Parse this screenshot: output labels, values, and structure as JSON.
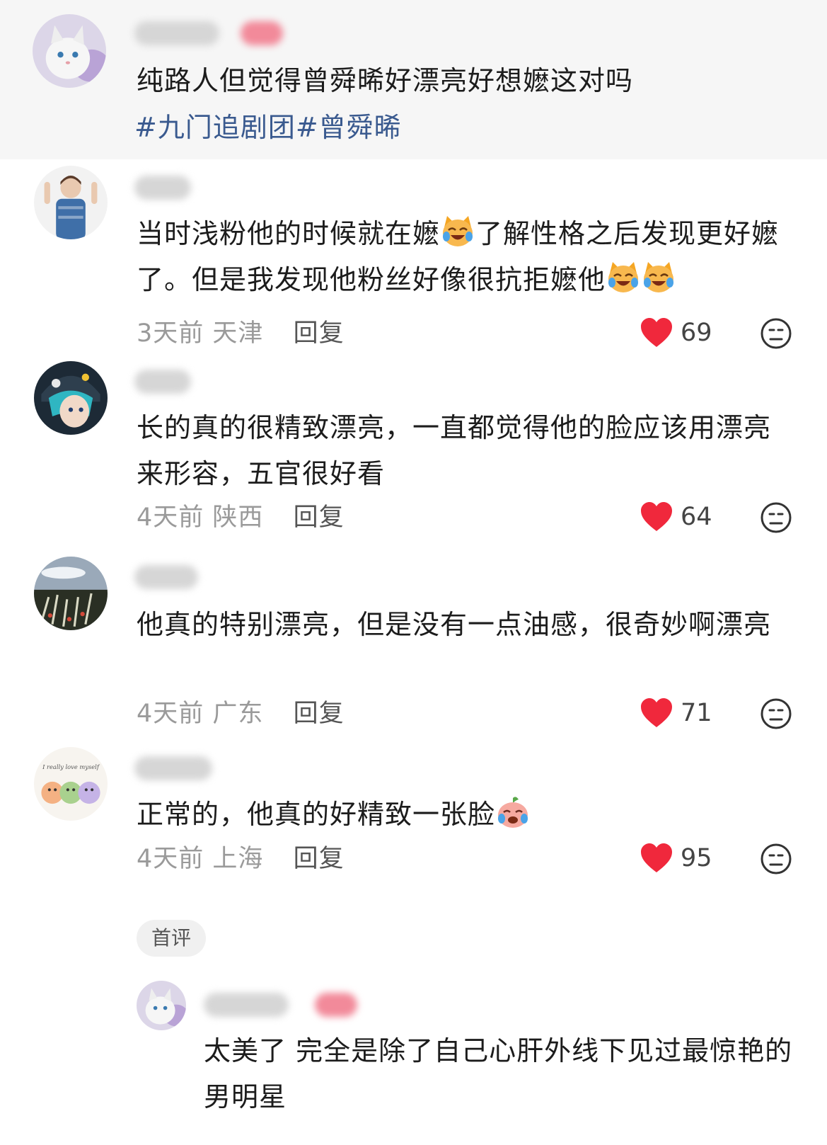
{
  "pinned": {
    "text": "纯路人但觉得曾舜晞好漂亮好想嬷这对吗",
    "tags": "#九门追剧团#曾舜晞"
  },
  "comments": [
    {
      "text_part1": "当时浅粉他的时候就在嬷",
      "text_part2": "了解性格之后发现更好嬷了。但是我发现他粉丝好像很抗拒嬷他",
      "time": "3天前",
      "location": "天津",
      "reply": "回复",
      "likes": "69"
    },
    {
      "text": "长的真的很精致漂亮，一直都觉得他的脸应该用漂亮来形容，五官很好看",
      "time": "4天前",
      "location": "陕西",
      "reply": "回复",
      "likes": "64"
    },
    {
      "text": "他真的特别漂亮，但是没有一点油感，很奇妙啊漂亮",
      "time": "4天前",
      "location": "广东",
      "reply": "回复",
      "likes": "71"
    },
    {
      "text": "正常的，他真的好精致一张脸",
      "time": "4天前",
      "location": "上海",
      "reply": "回复",
      "likes": "95",
      "badge": "首评"
    }
  ],
  "sub_reply": {
    "avatar_text": "I really love myself",
    "text": "太美了 完全是除了自己心肝外线下见过最惊艳的男明星"
  },
  "colors": {
    "like_heart": "#f0283c",
    "tag": "#3a5a8f",
    "meta": "#9a9a9a",
    "pinned_bg": "#f6f6f6"
  }
}
